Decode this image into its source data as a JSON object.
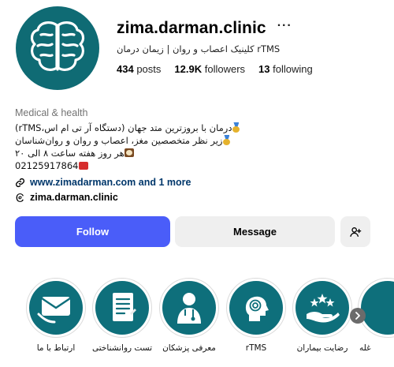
{
  "profile": {
    "username": "zima.darman.clinic",
    "more_glyph": "···",
    "full_name": "کلینیک اعصاب و روان | زیمان درمان rTMS",
    "stats": {
      "posts_count": "434",
      "posts_label": "posts",
      "followers_count": "12.9K",
      "followers_label": "followers",
      "following_count": "13",
      "following_label": "following"
    },
    "avatar_icon": "brain-icon"
  },
  "bio": {
    "category": "Medical & health",
    "lines": [
      "درمان با بروزترین متد جهان (دستگاه آر تی ام اس،rTMS)",
      "زیر نظر متخصصین مغز، اعصاب و روان و روان‌شناسان",
      "هر روز هفته ساعت ۸ الی ۲۰",
      "02125917864"
    ],
    "link_text": "www.zimadarman.com and 1 more",
    "threads_text": "zima.darman.clinic"
  },
  "actions": {
    "follow_label": "Follow",
    "message_label": "Message",
    "add_icon": "add-person-icon"
  },
  "highlights": [
    {
      "label": "ارتباط با ما",
      "icon": "mail-icon"
    },
    {
      "label": "تست روانشناختی",
      "icon": "document-icon"
    },
    {
      "label": "معرفی پزشکان",
      "icon": "doctor-icon"
    },
    {
      "label": "rTMS",
      "icon": "head-signal-icon"
    },
    {
      "label": "رضایت بیماران",
      "icon": "stars-hand-icon"
    },
    {
      "label": "غله",
      "icon": "partial-icon"
    }
  ],
  "colors": {
    "follow_button": "#4a5df9",
    "secondary_button": "#efefef",
    "brand_teal": "#0f6b74",
    "link": "#00376b"
  }
}
